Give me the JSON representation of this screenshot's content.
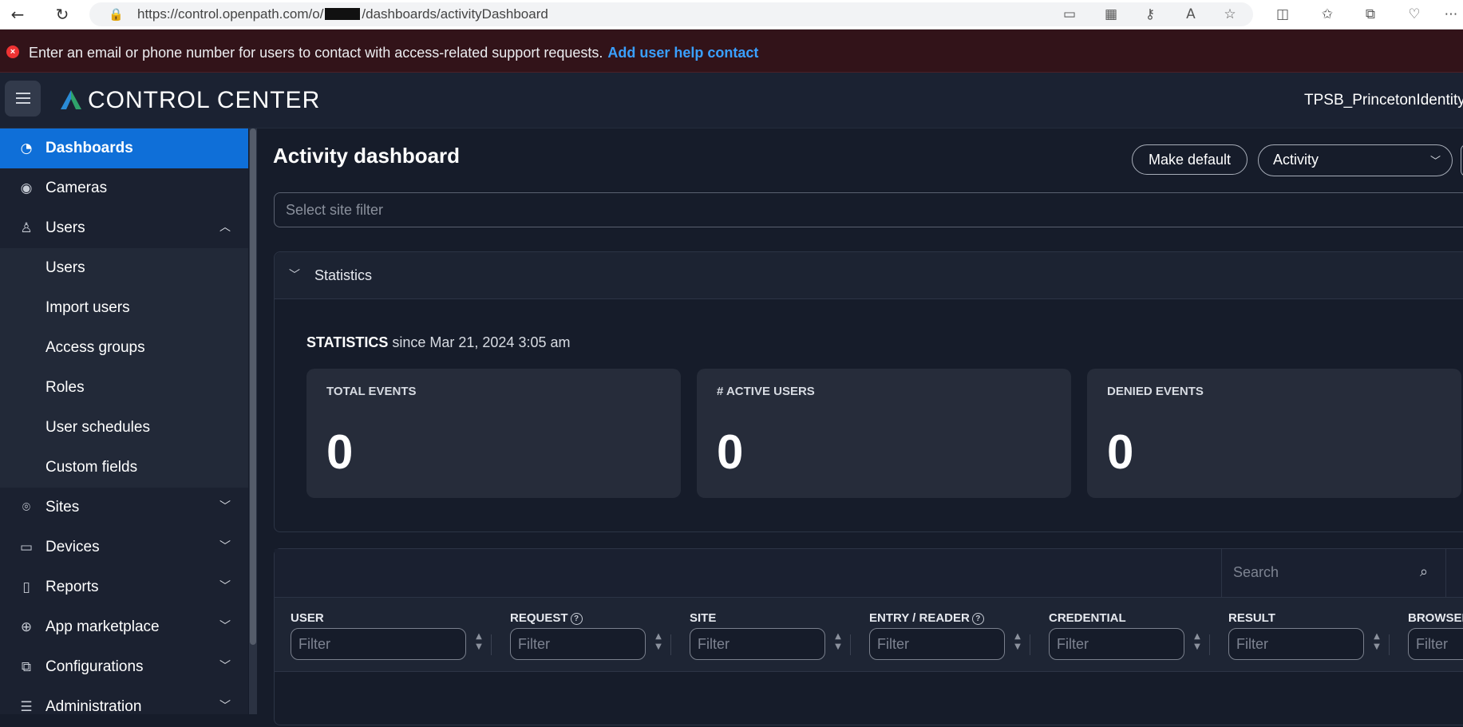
{
  "browser": {
    "url_prefix": "https://control.openpath.com/o/",
    "url_suffix": "/dashboards/activityDashboard"
  },
  "alert": {
    "message": "Enter an email or phone number for users to contact with access-related support requests.",
    "link": "Add user help contact"
  },
  "header": {
    "app_title": "CONTROL CENTER",
    "org_name": "TPSB_PrincetonIdentity"
  },
  "sidebar": {
    "items": [
      {
        "label": "Dashboards",
        "icon": "pie-chart-icon"
      },
      {
        "label": "Cameras",
        "icon": "camera-icon"
      },
      {
        "label": "Users",
        "icon": "user-icon"
      },
      {
        "label": "Sites",
        "icon": "location-pin-icon"
      },
      {
        "label": "Devices",
        "icon": "device-icon"
      },
      {
        "label": "Reports",
        "icon": "report-icon"
      },
      {
        "label": "App marketplace",
        "icon": "globe-icon"
      },
      {
        "label": "Configurations",
        "icon": "config-icon"
      },
      {
        "label": "Administration",
        "icon": "sliders-icon"
      }
    ],
    "users_sub": [
      "Users",
      "Import users",
      "Access groups",
      "Roles",
      "User schedules",
      "Custom fields"
    ]
  },
  "main": {
    "title": "Activity dashboard",
    "make_default": "Make default",
    "view_select": "Activity",
    "site_filter_placeholder": "Select site filter"
  },
  "statistics": {
    "section_title": "Statistics",
    "heading": "STATISTICS",
    "since": "since Mar 21, 2024 3:05 am",
    "cards": [
      {
        "label": "TOTAL EVENTS",
        "value": "0"
      },
      {
        "label": "# ACTIVE USERS",
        "value": "0"
      },
      {
        "label": "DENIED EVENTS",
        "value": "0"
      }
    ]
  },
  "table": {
    "search_placeholder": "Search",
    "filter_placeholder": "Filter",
    "columns": [
      "USER",
      "REQUEST",
      "SITE",
      "ENTRY / READER",
      "CREDENTIAL",
      "RESULT",
      "BROWSER"
    ]
  },
  "colors": {
    "accent": "#0f6fd8",
    "alert_bg": "#321319",
    "link": "#3aa0ff"
  }
}
